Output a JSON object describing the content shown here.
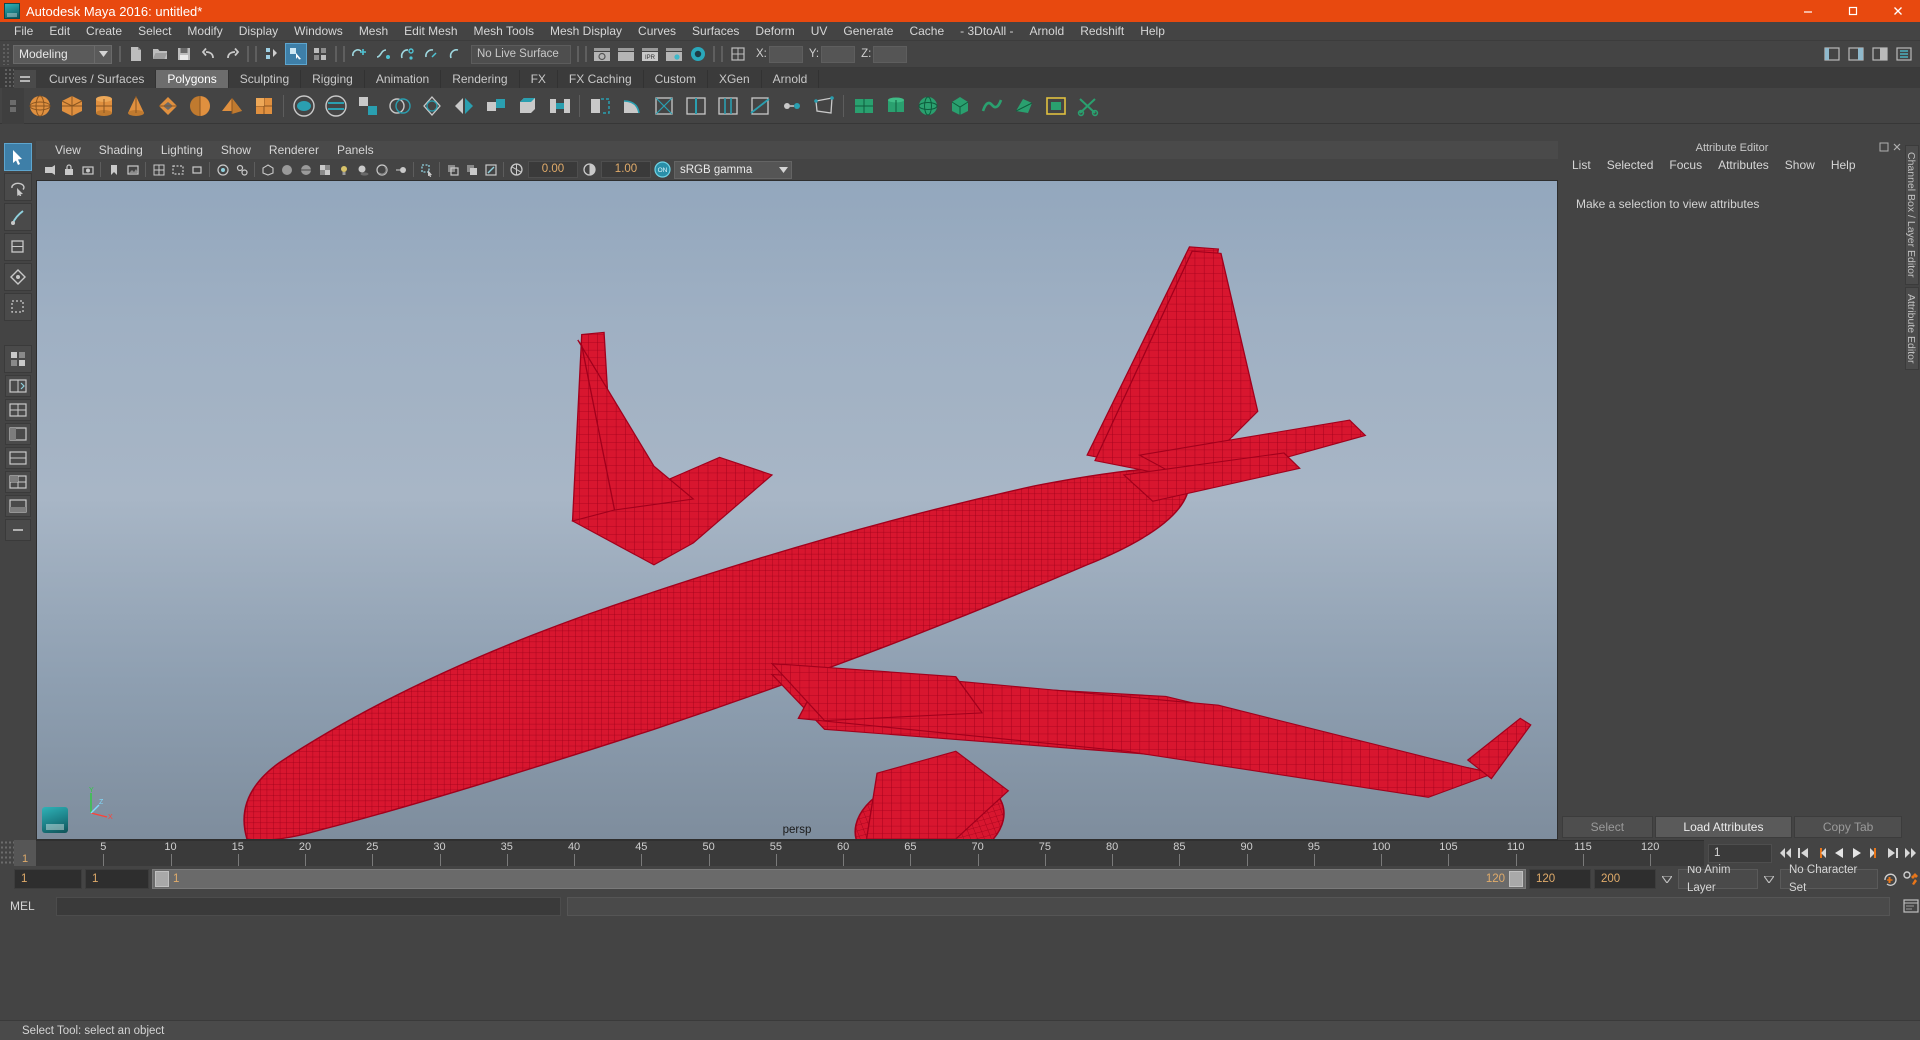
{
  "window": {
    "title": "Autodesk Maya 2016: untitled*",
    "logo_icon": "maya-logo-icon",
    "minimize_icon": "minimize-icon",
    "maximize_icon": "maximize-icon",
    "close_icon": "close-icon",
    "titlebar_color": "#e8490f"
  },
  "menubar": {
    "items": [
      "File",
      "Edit",
      "Create",
      "Select",
      "Modify",
      "Display",
      "Windows",
      "Mesh",
      "Edit Mesh",
      "Mesh Tools",
      "Mesh Display",
      "Curves",
      "Surfaces",
      "Deform",
      "UV",
      "Generate",
      "Cache",
      "- 3DtoAll -",
      "Arnold",
      "Redshift",
      "Help"
    ]
  },
  "toolbar": {
    "mode": "Modeling",
    "mode_arrow_icon": "chevron-down-icon",
    "live_surface": "No Live Surface",
    "axis_labels": [
      "X:",
      "Y:",
      "Z:"
    ],
    "axis_values": [
      "",
      "",
      ""
    ],
    "icons_group1": [
      "new-scene-icon",
      "open-scene-icon",
      "save-scene-icon",
      "undo-icon",
      "redo-icon"
    ],
    "icons_group2": [
      "select-hierarchy-icon",
      "select-object-icon",
      "select-component-icon"
    ],
    "icons_group3": [
      "snap-to-grid-icon",
      "snap-to-curve-icon",
      "snap-to-point-icon",
      "snap-to-projected-icon",
      "snap-to-view-plane-icon"
    ],
    "icons_group4": [
      "render-view-icon",
      "render-sequence-icon",
      "ipr-render-icon",
      "render-settings-icon",
      "hypershade-icon"
    ],
    "icons_right": [
      "show-editor-icon",
      "outliner-icon",
      "attribute-editor-toggle-icon",
      "channel-box-toggle-icon"
    ]
  },
  "shelf": {
    "menu_icon": "shelf-menu-icon",
    "tabs": [
      "Curves / Surfaces",
      "Polygons",
      "Sculpting",
      "Rigging",
      "Animation",
      "Rendering",
      "FX",
      "FX Caching",
      "Custom",
      "XGen",
      "Arnold"
    ],
    "active_tab": "Polygons",
    "poly_primitives": [
      "polygon-sphere-icon",
      "polygon-cube-icon",
      "polygon-cylinder-icon",
      "polygon-cone-icon",
      "polygon-torus-icon",
      "polygon-plane-icon",
      "polygon-pyramid-icon",
      "polygon-prism-icon"
    ],
    "poly_ops": [
      "combine-icon",
      "separate-icon",
      "extract-icon",
      "booleans-icon",
      "smooth-icon",
      "mirror-geometry-icon",
      "extrude-icon",
      "bevel-icon",
      "bridge-icon",
      "append-polygon-icon",
      "wedge-icon",
      "poke-face-icon",
      "insert-edge-loop-icon",
      "offset-edge-loop-icon",
      "multi-cut-icon",
      "target-weld-icon",
      "quad-draw-icon"
    ],
    "uv_ops": [
      "uv-planar-icon",
      "uv-cylindrical-icon",
      "uv-spherical-icon",
      "uv-automatic-icon",
      "uv-contour-stretch-icon",
      "uv-camera-based-icon",
      "uv-editor-icon",
      "uv-cut-icon"
    ]
  },
  "tool_column": {
    "items": [
      "select-tool-icon",
      "lasso-select-tool-icon",
      "paint-select-tool-icon",
      "move-tool-icon",
      "rotate-tool-icon",
      "scale-tool-icon",
      "last-tool-icon",
      "snap-grid-icon",
      "snap-curve-icon",
      "snap-point-icon",
      "snap-view-icon",
      "snap-live-icon",
      "layout-single-icon",
      "layout-quad-icon",
      "layout-outliner-icon",
      "layout-persp-graph-icon",
      "layout-hypershade-icon",
      "layout-more-icon"
    ],
    "selected": "select-tool-icon"
  },
  "viewport": {
    "menus": [
      "View",
      "Shading",
      "Lighting",
      "Show",
      "Renderer",
      "Panels"
    ],
    "camera_label": "persp",
    "exposure_value": "0.00",
    "gamma_value": "1.00",
    "color_management": "sRGB gamma",
    "color_management_toggle": "ON",
    "toolbar_icons": [
      "select-camera-icon",
      "lock-camera-icon",
      "camera-attributes-icon",
      "bookmark-icon",
      "image-plane-icon",
      "twopane-icon",
      "grid-toggle-icon",
      "film-gate-icon",
      "resolution-gate-icon",
      "gate-mask-icon",
      "xray-toggle-icon",
      "xray-joints-icon",
      "shaded-icon",
      "wireframe-on-shaded-icon",
      "textured-icon",
      "use-all-lights-icon",
      "shadows-icon",
      "screen-space-ao-icon",
      "motion-blur-icon",
      "multisample-icon",
      "depth-of-field-icon",
      "isolate-select-icon",
      "grid-icon",
      "film-icon",
      "panel-zoom-icon",
      "exposure-icon",
      "gamma-icon"
    ],
    "gizmo_axes": [
      "Y",
      "X",
      "Z"
    ],
    "model_name": "airplane-wireframe-model",
    "model_color": "#d8162f",
    "background_top": "#93a7bd",
    "background_bottom": "#7e8d9d"
  },
  "attribute_editor": {
    "panel_title": "Attribute Editor",
    "dock_icon": "dock-icon",
    "close_icon": "close-icon",
    "menus": [
      "List",
      "Selected",
      "Focus",
      "Attributes",
      "Show",
      "Help"
    ],
    "empty_message": "Make a selection to view attributes",
    "buttons": [
      "Select",
      "Load Attributes",
      "Copy Tab"
    ],
    "primary_button": "Load Attributes"
  },
  "side_tabs": [
    "Channel Box / Layer Editor",
    "Attribute Editor"
  ],
  "timeline": {
    "ticks": [
      5,
      10,
      15,
      20,
      25,
      30,
      35,
      40,
      45,
      50,
      55,
      60,
      65,
      70,
      75,
      80,
      85,
      90,
      95,
      100,
      105,
      110,
      115,
      120
    ],
    "current_frame_marker": "1",
    "current_frame_field": "1",
    "playback_icons": [
      "go-to-start-icon",
      "step-back-keyframe-icon",
      "step-back-frame-icon",
      "play-backwards-icon",
      "play-forwards-icon",
      "step-forward-frame-icon",
      "step-forward-keyframe-icon",
      "go-to-end-icon"
    ]
  },
  "range_slider": {
    "anim_start": "1",
    "range_start": "1",
    "range_bar_label_left": "1",
    "range_bar_label_right": "120",
    "range_end": "120",
    "anim_end": "200",
    "anim_layer": "No Anim Layer",
    "character_set": "No Character Set",
    "auto_key_icon": "auto-keyframe-icon",
    "anim_prefs_icon": "animation-preferences-icon",
    "dropdown_icon": "chevron-down-icon"
  },
  "command_line": {
    "language_label": "MEL",
    "input_value": "",
    "output_value": "",
    "script_editor_icon": "script-editor-icon"
  },
  "status_line": {
    "text": "Select Tool: select an object"
  }
}
